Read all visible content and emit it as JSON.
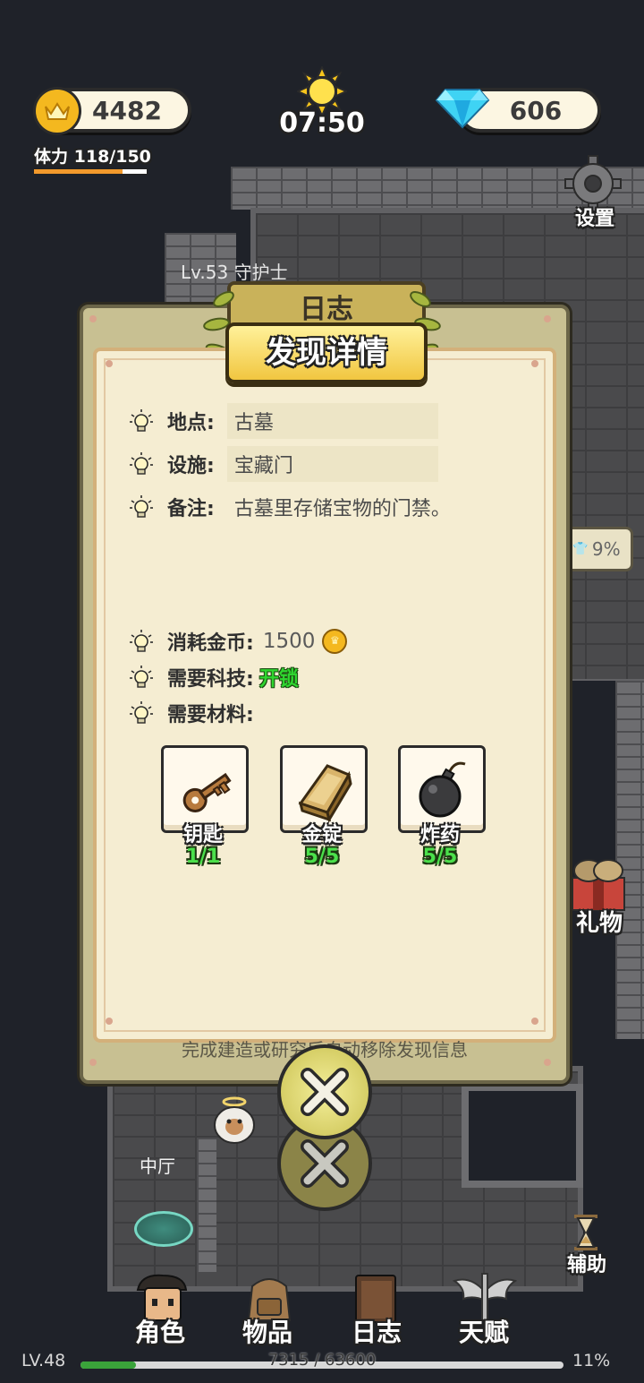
{
  "hud": {
    "gold": "4482",
    "time": "07:50",
    "gems": "606",
    "stamina_label": "体力",
    "stamina_value": "118/150",
    "stamina_fraction": 0.787,
    "settings_label": "设置"
  },
  "map": {
    "npc_label": "Lv.53 守护士",
    "room_label": "中厅",
    "progress_badge": "9%",
    "gift_label": "礼物",
    "assist_label": "辅助"
  },
  "modal": {
    "header_back": "日志",
    "title": "发现详情",
    "location_label": "地点:",
    "location_value": "古墓",
    "facility_label": "设施:",
    "facility_value": "宝藏门",
    "note_label": "备注:",
    "note_value": "古墓里存储宝物的门禁。",
    "cost_label": "消耗金币:",
    "cost_value": "1500",
    "tech_label": "需要科技:",
    "tech_value": "开锁",
    "materials_label": "需要材料:",
    "materials": [
      {
        "name": "钥匙",
        "count": "1/1",
        "icon": "key-icon"
      },
      {
        "name": "金锭",
        "count": "5/5",
        "icon": "gold-ingot-icon"
      },
      {
        "name": "炸药",
        "count": "5/5",
        "icon": "bomb-icon"
      }
    ],
    "footer_note": "完成建造或研究后自动移除发现信息"
  },
  "nav": {
    "tabs": [
      {
        "label": "角色",
        "icon": "character-icon"
      },
      {
        "label": "物品",
        "icon": "backpack-icon"
      },
      {
        "label": "日志",
        "icon": "journal-icon"
      },
      {
        "label": "天赋",
        "icon": "talent-wings-icon"
      }
    ]
  },
  "xp": {
    "level": "LV.48",
    "value": "7315 / 63600",
    "percent": "11%",
    "fraction": 0.115
  },
  "colors": {
    "gold_accent": "#f4b81f",
    "tech_green": "#2fd62f",
    "modal_bg": "#f5edd2"
  }
}
